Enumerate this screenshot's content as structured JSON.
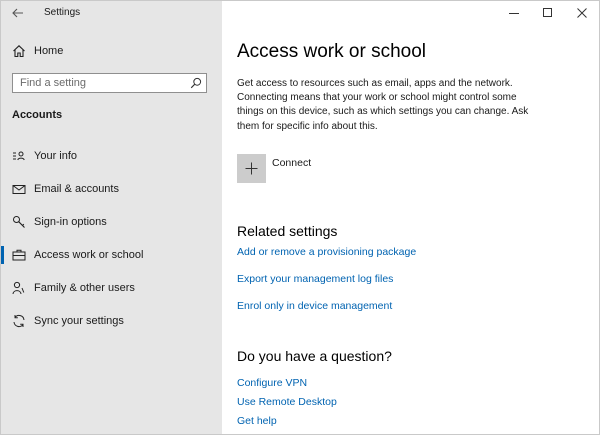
{
  "window": {
    "title": "Settings"
  },
  "sidebar": {
    "home_label": "Home",
    "search_placeholder": "Find a setting",
    "section_title": "Accounts",
    "items": [
      {
        "label": "Your info",
        "icon": "person-card-icon"
      },
      {
        "label": "Email & accounts",
        "icon": "mail-icon"
      },
      {
        "label": "Sign-in options",
        "icon": "key-icon"
      },
      {
        "label": "Access work or school",
        "icon": "briefcase-icon",
        "active": true
      },
      {
        "label": "Family & other users",
        "icon": "people-icon"
      },
      {
        "label": "Sync your settings",
        "icon": "sync-icon"
      }
    ]
  },
  "main": {
    "title": "Access work or school",
    "description": "Get access to resources such as email, apps and the network. Connecting means that your work or school might control some things on this device, such as which settings you can change. Ask them for specific info about this.",
    "connect_label": "Connect",
    "related_heading": "Related settings",
    "related_links": [
      "Add or remove a provisioning package",
      "Export your management log files",
      "Enrol only in device management"
    ],
    "question_heading": "Do you have a question?",
    "help_links": [
      "Configure VPN",
      "Use Remote Desktop",
      "Get help"
    ]
  },
  "colors": {
    "accent": "#0063b1",
    "sidebar_bg": "#e6e6e6",
    "connect_tile_bg": "#cccccc"
  }
}
